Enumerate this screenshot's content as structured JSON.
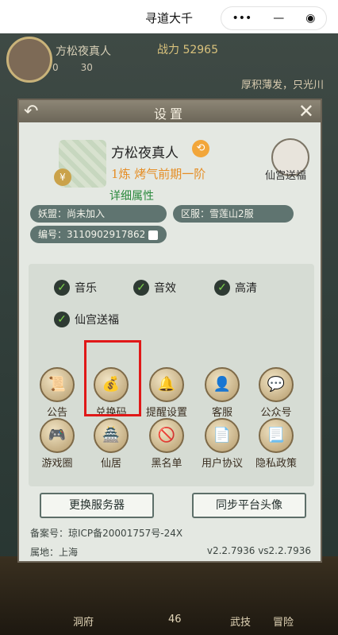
{
  "window": {
    "title": "寻道大千",
    "capsule_icons": [
      "more-icon",
      "minimize-icon",
      "close-target-icon"
    ]
  },
  "hud": {
    "player": "方松夜真人",
    "power_label": "战力",
    "power_value": "52965",
    "stats": [
      "0",
      "30"
    ],
    "slogan": "厚积薄发，只光川"
  },
  "dialog": {
    "title": "设置",
    "player_name": "方松夜真人",
    "rank": "1炼 烤气前期一阶",
    "gift_label": "仙宫送福",
    "detail_link": "详细属性",
    "guild": "妖盟：尚未加入",
    "server": "区服：雪莲山2服",
    "id": "编号：3110902917862",
    "checks": [
      "音乐",
      "音效",
      "高清",
      "仙宫送福"
    ],
    "icons": [
      "公告",
      "兑换码",
      "提醒设置",
      "客服",
      "公众号",
      "游戏圈",
      "仙居",
      "黑名单",
      "用户协议",
      "隐私政策"
    ],
    "btn_change_server": "更换服务器",
    "btn_sync_avatar": "同步平台头像",
    "record": "备案号：琼ICP备20001757号-24X",
    "location": "属地：上海",
    "version": "v2.2.7936 vs2.2.7936"
  },
  "bottom": {
    "items": [
      "洞府",
      "46",
      "武技",
      "冒险"
    ]
  }
}
